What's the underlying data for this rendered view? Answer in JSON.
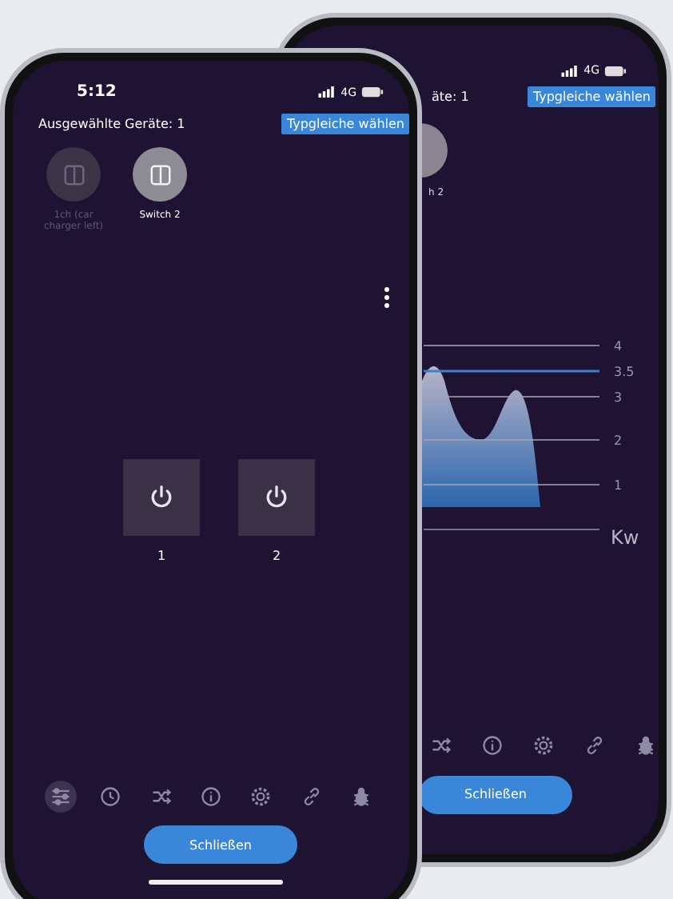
{
  "back_phone": {
    "status_bar": {
      "network": "4G"
    },
    "header": {
      "selected_count": "äte: 1",
      "select_same_button": "Typgleiche wählen"
    },
    "devices": [
      {
        "name": "h 2",
        "selected": true
      }
    ],
    "power_graph": {
      "axis_labels": [
        {
          "label": "4",
          "kind": "grid"
        },
        {
          "label": "3.5",
          "kind": "threshold"
        },
        {
          "label": "3",
          "kind": "grid"
        },
        {
          "label": "2",
          "kind": "grid"
        },
        {
          "label": "1",
          "kind": "grid"
        }
      ],
      "unit": "Kw"
    },
    "tabs": [
      {
        "kind": "shuffle",
        "selected": false
      },
      {
        "kind": "info",
        "selected": false
      },
      {
        "kind": "gear",
        "selected": false
      },
      {
        "kind": "link",
        "selected": false
      },
      {
        "kind": "bug",
        "selected": false
      }
    ],
    "close_button": "Schließen"
  },
  "front_phone": {
    "status_bar": {
      "time": "5:12",
      "network": "4G"
    },
    "header": {
      "selected_count": "Ausgewählte Geräte: 1",
      "select_same_button": "Typgleiche wählen"
    },
    "devices": [
      {
        "name": "1ch (car charger left)",
        "selected": false
      },
      {
        "name": "Switch 2",
        "selected": true
      }
    ],
    "channels": [
      {
        "label": "1"
      },
      {
        "label": "2"
      }
    ],
    "tabs": [
      {
        "kind": "sliders",
        "selected": true
      },
      {
        "kind": "clock",
        "selected": false
      },
      {
        "kind": "shuffle",
        "selected": false
      },
      {
        "kind": "info",
        "selected": false
      },
      {
        "kind": "gear",
        "selected": false
      },
      {
        "kind": "link",
        "selected": false
      },
      {
        "kind": "bug",
        "selected": false
      }
    ],
    "close_button": "Schließen"
  }
}
